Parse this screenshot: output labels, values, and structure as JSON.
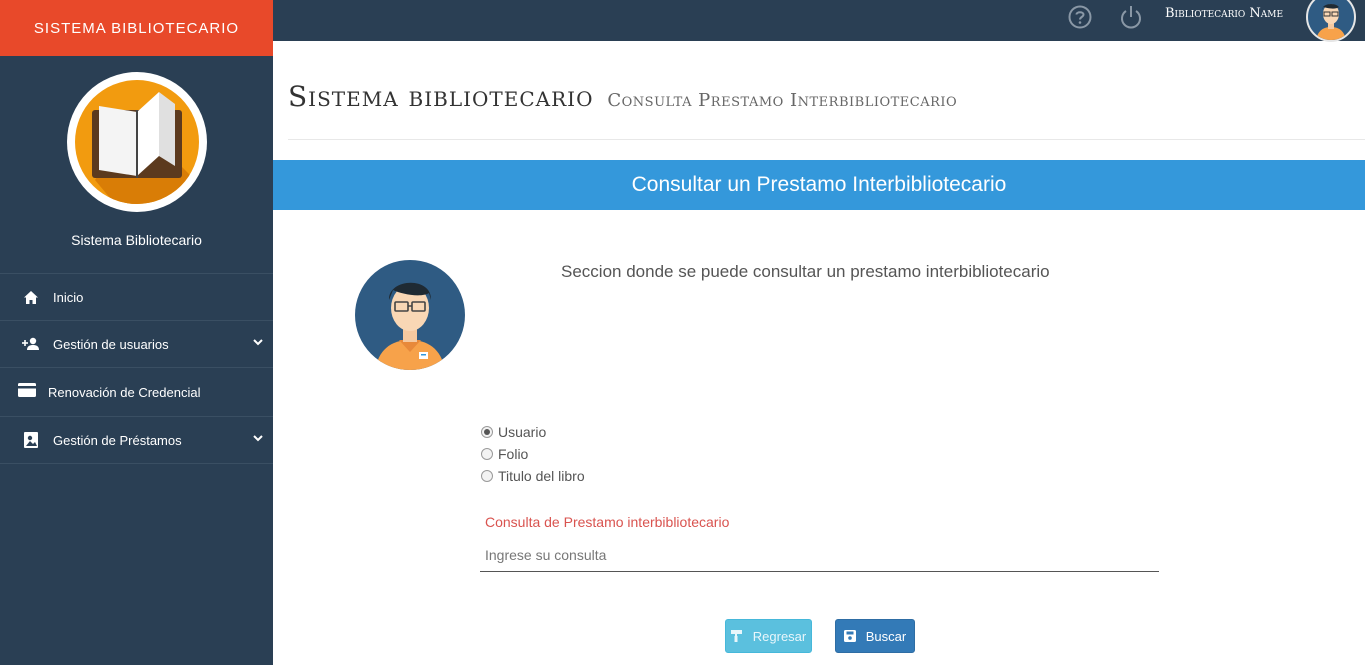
{
  "sidebar": {
    "brand": "SISTEMA BIBLIOTECARIO",
    "subtitle": "Sistema Bibliotecario",
    "items": [
      {
        "label": "Inicio",
        "icon": "home-icon"
      },
      {
        "label": "Gestión de usuarios",
        "icon": "add-user-icon",
        "expandable": true
      },
      {
        "label": "Renovación de Credencial",
        "icon": "credit-card-icon"
      },
      {
        "label": "Gestión de Préstamos",
        "icon": "photo-book-icon",
        "expandable": true
      }
    ]
  },
  "topbar": {
    "user_name": "Bibliotecario Name",
    "icons": [
      "help-icon",
      "power-icon"
    ]
  },
  "page": {
    "title": "Sistema bibliotecario",
    "subtitle": "Consulta Prestamo Interbibliotecario"
  },
  "panel": {
    "header": "Consultar un Prestamo Interbibliotecario",
    "description": "Seccion donde se puede consultar un prestamo interbibliotecario",
    "radios": [
      {
        "label": "Usuario",
        "checked": true
      },
      {
        "label": "Folio",
        "checked": false
      },
      {
        "label": "Titulo del libro",
        "checked": false
      }
    ],
    "field_label": "Consulta de Prestamo interbibliotecario",
    "field_placeholder": "Ingrese su consulta",
    "back_label": "Regresar",
    "search_label": "Buscar"
  },
  "colors": {
    "brand": "#e8492a",
    "sidebar": "#2a3f54",
    "panel_header": "#3498db",
    "label_red": "#d9534f",
    "btn_info": "#5bc0de",
    "btn_primary": "#337ab7"
  }
}
